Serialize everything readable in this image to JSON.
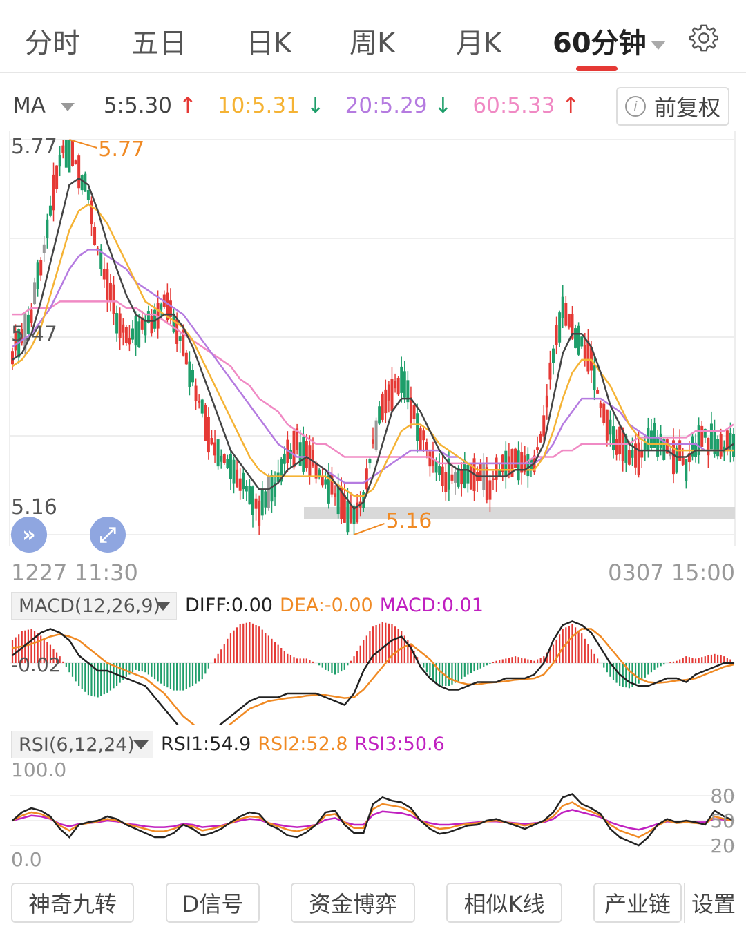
{
  "tabs": [
    "分时",
    "五日",
    "日K",
    "周K",
    "月K",
    "60分钟"
  ],
  "active_tab": "60分钟",
  "ma_bar": {
    "label": "MA",
    "ma5": "5:5.30",
    "ma10": "10:5.31",
    "ma20": "20:5.29",
    "ma60": "60:5.33",
    "adjust_button": "前复权"
  },
  "colors": {
    "up": "#e53935",
    "down": "#1e9e6a",
    "neutral": "#999999",
    "ma5": "#444444",
    "ma10": "#f5b335",
    "ma20": "#b57be0",
    "ma60": "#f08ac4",
    "diff": "#222222",
    "dea": "#f08a24",
    "macd": "#c020c0"
  },
  "price_panel": {
    "y_ticks": [
      "5.77",
      "5.47",
      "5.16"
    ],
    "high_label": "5.77",
    "low_label": "5.16",
    "start_time": "1227 11:30",
    "end_time": "0307 15:00"
  },
  "macd_panel": {
    "selector": "MACD(12,26,9)",
    "diff": "DIFF:0.00",
    "dea": "DEA:-0.00",
    "macd": "MACD:0.01",
    "axis_label": "-0.02"
  },
  "rsi_panel": {
    "selector": "RSI(6,12,24)",
    "rsi1": "RSI1:54.9",
    "rsi2": "RSI2:52.8",
    "rsi3": "RSI3:50.6",
    "left_ticks": [
      "100.0",
      "0.0"
    ],
    "right_ticks": [
      "80",
      "50",
      "20"
    ]
  },
  "bottom_buttons": [
    "神奇九转",
    "D信号",
    "资金博弈",
    "相似K线",
    "产业链",
    "设置"
  ],
  "chart_data": {
    "type": "candlestick",
    "period": "60分钟",
    "y_range": [
      5.16,
      5.77
    ],
    "x_range": [
      "1227 11:30",
      "0307 15:00"
    ],
    "close_path": [
      5.44,
      5.46,
      5.5,
      5.58,
      5.66,
      5.74,
      5.77,
      5.72,
      5.68,
      5.6,
      5.55,
      5.5,
      5.46,
      5.47,
      5.49,
      5.5,
      5.52,
      5.49,
      5.45,
      5.4,
      5.35,
      5.3,
      5.28,
      5.26,
      5.24,
      5.22,
      5.2,
      5.22,
      5.25,
      5.28,
      5.3,
      5.28,
      5.26,
      5.24,
      5.22,
      5.2,
      5.18,
      5.22,
      5.3,
      5.35,
      5.38,
      5.4,
      5.36,
      5.32,
      5.28,
      5.26,
      5.25,
      5.25,
      5.26,
      5.25,
      5.24,
      5.25,
      5.26,
      5.27,
      5.26,
      5.28,
      5.32,
      5.44,
      5.5,
      5.48,
      5.46,
      5.42,
      5.36,
      5.32,
      5.3,
      5.29,
      5.28,
      5.3,
      5.31,
      5.29,
      5.28,
      5.27,
      5.3,
      5.31,
      5.3,
      5.29,
      5.31
    ],
    "ma_lines": {
      "ma5": [
        5.43,
        5.44,
        5.47,
        5.52,
        5.58,
        5.64,
        5.7,
        5.71,
        5.7,
        5.66,
        5.61,
        5.57,
        5.53,
        5.5,
        5.49,
        5.49,
        5.5,
        5.5,
        5.48,
        5.45,
        5.41,
        5.37,
        5.33,
        5.29,
        5.27,
        5.25,
        5.23,
        5.23,
        5.24,
        5.26,
        5.27,
        5.28,
        5.27,
        5.26,
        5.24,
        5.22,
        5.2,
        5.21,
        5.25,
        5.3,
        5.35,
        5.37,
        5.37,
        5.35,
        5.32,
        5.29,
        5.27,
        5.26,
        5.26,
        5.25,
        5.25,
        5.25,
        5.25,
        5.26,
        5.26,
        5.27,
        5.3,
        5.37,
        5.44,
        5.47,
        5.47,
        5.45,
        5.41,
        5.36,
        5.33,
        5.3,
        5.29,
        5.29,
        5.29,
        5.29,
        5.28,
        5.28,
        5.29,
        5.29,
        5.29,
        5.29,
        5.3
      ],
      "ma10": [
        5.42,
        5.43,
        5.45,
        5.48,
        5.53,
        5.58,
        5.63,
        5.66,
        5.67,
        5.66,
        5.64,
        5.61,
        5.58,
        5.55,
        5.52,
        5.51,
        5.5,
        5.49,
        5.48,
        5.46,
        5.43,
        5.4,
        5.37,
        5.34,
        5.31,
        5.28,
        5.26,
        5.25,
        5.25,
        5.25,
        5.25,
        5.25,
        5.25,
        5.25,
        5.24,
        5.23,
        5.22,
        5.22,
        5.23,
        5.26,
        5.29,
        5.32,
        5.33,
        5.33,
        5.32,
        5.3,
        5.29,
        5.28,
        5.27,
        5.26,
        5.26,
        5.26,
        5.26,
        5.26,
        5.26,
        5.26,
        5.28,
        5.32,
        5.37,
        5.41,
        5.43,
        5.43,
        5.41,
        5.39,
        5.36,
        5.33,
        5.31,
        5.3,
        5.3,
        5.3,
        5.29,
        5.29,
        5.29,
        5.29,
        5.29,
        5.29,
        5.29
      ],
      "ma20": [
        5.45,
        5.46,
        5.47,
        5.49,
        5.51,
        5.54,
        5.57,
        5.59,
        5.6,
        5.6,
        5.59,
        5.58,
        5.57,
        5.55,
        5.54,
        5.53,
        5.52,
        5.51,
        5.5,
        5.48,
        5.46,
        5.44,
        5.42,
        5.4,
        5.38,
        5.36,
        5.34,
        5.32,
        5.3,
        5.29,
        5.28,
        5.28,
        5.27,
        5.26,
        5.25,
        5.24,
        5.24,
        5.24,
        5.25,
        5.26,
        5.27,
        5.28,
        5.29,
        5.29,
        5.29,
        5.29,
        5.28,
        5.28,
        5.27,
        5.27,
        5.27,
        5.27,
        5.27,
        5.27,
        5.27,
        5.27,
        5.28,
        5.3,
        5.33,
        5.35,
        5.37,
        5.37,
        5.37,
        5.36,
        5.35,
        5.33,
        5.32,
        5.31,
        5.31,
        5.3,
        5.3,
        5.3,
        5.3,
        5.29,
        5.29,
        5.29,
        5.29
      ],
      "ma60": [
        5.5,
        5.5,
        5.51,
        5.51,
        5.51,
        5.52,
        5.52,
        5.52,
        5.52,
        5.52,
        5.52,
        5.52,
        5.51,
        5.51,
        5.5,
        5.5,
        5.49,
        5.48,
        5.47,
        5.46,
        5.45,
        5.44,
        5.43,
        5.42,
        5.4,
        5.39,
        5.37,
        5.36,
        5.35,
        5.33,
        5.32,
        5.31,
        5.3,
        5.3,
        5.29,
        5.28,
        5.28,
        5.28,
        5.28,
        5.28,
        5.28,
        5.28,
        5.28,
        5.28,
        5.28,
        5.27,
        5.27,
        5.27,
        5.27,
        5.27,
        5.27,
        5.27,
        5.27,
        5.27,
        5.27,
        5.28,
        5.28,
        5.28,
        5.29,
        5.29,
        5.3,
        5.3,
        5.3,
        5.3,
        5.3,
        5.3,
        5.31,
        5.31,
        5.31,
        5.31,
        5.31,
        5.31,
        5.32,
        5.32,
        5.32,
        5.32,
        5.33
      ]
    },
    "macd_hist": [
      0.01,
      0.014,
      0.015,
      0.012,
      0.008,
      0.003,
      -0.004,
      -0.01,
      -0.014,
      -0.015,
      -0.013,
      -0.01,
      -0.006,
      -0.003,
      -0.004,
      -0.007,
      -0.01,
      -0.012,
      -0.012,
      -0.01,
      -0.007,
      0.0,
      0.006,
      0.013,
      0.017,
      0.018,
      0.016,
      0.012,
      0.008,
      0.004,
      0.002,
      0.002,
      0.0,
      -0.003,
      -0.005,
      -0.003,
      0.003,
      0.01,
      0.016,
      0.018,
      0.017,
      0.014,
      0.008,
      0.0,
      -0.006,
      -0.01,
      -0.01,
      -0.008,
      -0.005,
      -0.003,
      -0.001,
      0.001,
      0.002,
      0.003,
      0.002,
      0.001,
      0.003,
      0.008,
      0.015,
      0.017,
      0.013,
      0.006,
      0.0,
      -0.006,
      -0.01,
      -0.011,
      -0.009,
      -0.005,
      -0.002,
      0.0,
      0.001,
      0.003,
      0.002,
      0.003,
      0.004,
      0.003,
      0.001
    ],
    "macd_diff": [
      0.01,
      0.02,
      0.03,
      0.04,
      0.045,
      0.04,
      0.03,
      0.01,
      0.0,
      -0.01,
      -0.01,
      -0.015,
      -0.02,
      -0.025,
      -0.03,
      -0.045,
      -0.06,
      -0.075,
      -0.09,
      -0.095,
      -0.095,
      -0.09,
      -0.08,
      -0.07,
      -0.06,
      -0.05,
      -0.045,
      -0.045,
      -0.045,
      -0.04,
      -0.04,
      -0.04,
      -0.04,
      -0.045,
      -0.05,
      -0.055,
      -0.04,
      -0.01,
      0.01,
      0.02,
      0.03,
      0.035,
      0.02,
      -0.005,
      -0.02,
      -0.03,
      -0.035,
      -0.035,
      -0.03,
      -0.025,
      -0.025,
      -0.025,
      -0.02,
      -0.02,
      -0.02,
      -0.015,
      0.0,
      0.03,
      0.05,
      0.055,
      0.05,
      0.04,
      0.02,
      0.0,
      -0.015,
      -0.025,
      -0.03,
      -0.03,
      -0.025,
      -0.02,
      -0.02,
      -0.025,
      -0.015,
      -0.01,
      -0.005,
      0.0,
      0.0
    ],
    "macd_dea": [
      0.02,
      0.022,
      0.025,
      0.03,
      0.035,
      0.038,
      0.035,
      0.03,
      0.02,
      0.01,
      0.0,
      -0.005,
      -0.01,
      -0.015,
      -0.02,
      -0.03,
      -0.04,
      -0.055,
      -0.07,
      -0.08,
      -0.09,
      -0.095,
      -0.09,
      -0.08,
      -0.07,
      -0.06,
      -0.055,
      -0.05,
      -0.048,
      -0.046,
      -0.045,
      -0.043,
      -0.042,
      -0.042,
      -0.044,
      -0.046,
      -0.045,
      -0.035,
      -0.02,
      -0.005,
      0.01,
      0.02,
      0.025,
      0.015,
      0.005,
      -0.01,
      -0.02,
      -0.025,
      -0.028,
      -0.028,
      -0.026,
      -0.025,
      -0.024,
      -0.022,
      -0.021,
      -0.02,
      -0.015,
      0.0,
      0.02,
      0.035,
      0.045,
      0.045,
      0.035,
      0.02,
      0.005,
      -0.01,
      -0.02,
      -0.025,
      -0.026,
      -0.025,
      -0.023,
      -0.022,
      -0.02,
      -0.015,
      -0.01,
      -0.005,
      -0.002
    ],
    "rsi": {
      "rsi1": [
        50,
        60,
        65,
        62,
        55,
        40,
        30,
        45,
        48,
        50,
        55,
        52,
        45,
        40,
        35,
        30,
        30,
        35,
        45,
        40,
        32,
        35,
        40,
        48,
        55,
        60,
        58,
        45,
        40,
        32,
        30,
        36,
        45,
        60,
        62,
        45,
        35,
        35,
        70,
        78,
        74,
        72,
        65,
        50,
        40,
        34,
        36,
        40,
        44,
        45,
        50,
        52,
        48,
        44,
        40,
        45,
        50,
        60,
        78,
        82,
        70,
        65,
        58,
        40,
        30,
        25,
        20,
        30,
        45,
        52,
        48,
        50,
        48,
        45,
        62,
        55,
        50
      ],
      "rsi2": [
        50,
        56,
        60,
        58,
        53,
        44,
        38,
        45,
        47,
        49,
        52,
        50,
        46,
        43,
        40,
        37,
        37,
        40,
        45,
        43,
        38,
        40,
        43,
        47,
        52,
        55,
        54,
        47,
        43,
        39,
        37,
        40,
        45,
        56,
        58,
        48,
        41,
        41,
        64,
        70,
        68,
        66,
        61,
        50,
        44,
        40,
        41,
        44,
        46,
        47,
        49,
        50,
        48,
        46,
        44,
        46,
        49,
        55,
        68,
        72,
        65,
        61,
        56,
        45,
        38,
        34,
        30,
        36,
        44,
        50,
        47,
        48,
        47,
        46,
        55,
        52,
        50
      ],
      "rsi3": [
        50,
        53,
        56,
        55,
        52,
        46,
        43,
        46,
        47,
        48,
        50,
        49,
        46,
        45,
        43,
        42,
        42,
        43,
        46,
        45,
        42,
        43,
        44,
        47,
        50,
        52,
        51,
        47,
        45,
        43,
        42,
        43,
        45,
        51,
        53,
        48,
        45,
        45,
        57,
        61,
        60,
        59,
        56,
        50,
        47,
        45,
        45,
        46,
        47,
        48,
        49,
        49,
        48,
        47,
        46,
        47,
        48,
        52,
        60,
        63,
        60,
        57,
        54,
        48,
        44,
        41,
        39,
        42,
        46,
        49,
        48,
        48,
        48,
        48,
        52,
        51,
        50
      ]
    }
  }
}
